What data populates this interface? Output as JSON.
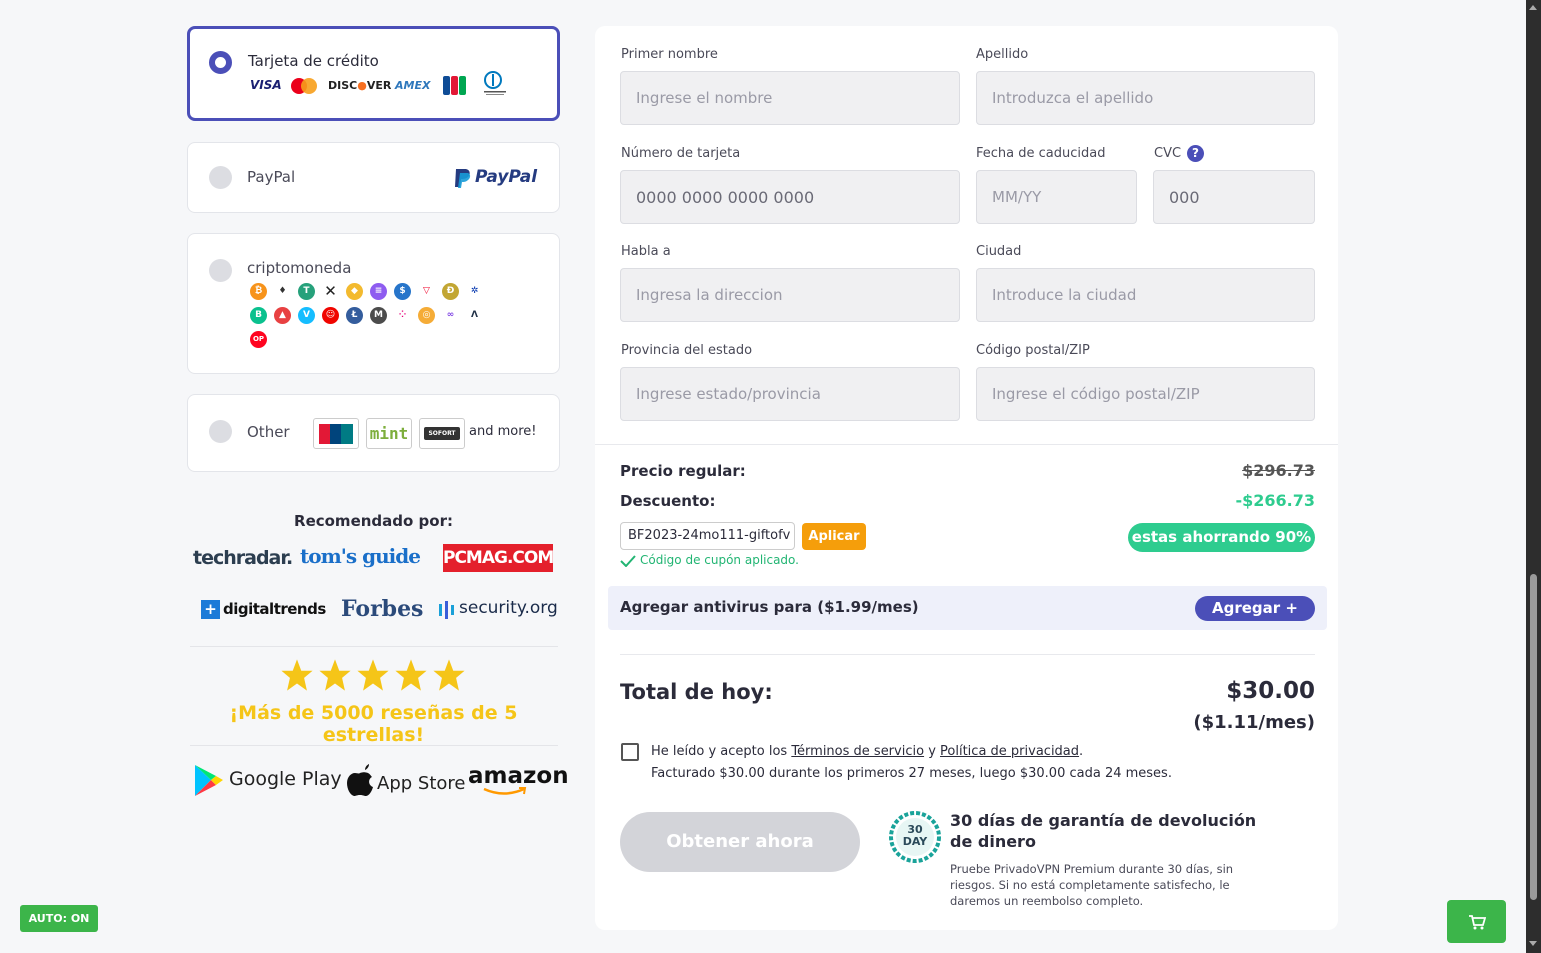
{
  "payment_methods": {
    "credit_card": {
      "title": "Tarjeta de crédito",
      "brands": [
        "VISA",
        "DISCOVER",
        "AMEX",
        "JCB",
        "Diners Club"
      ]
    },
    "paypal": {
      "title": "PayPal",
      "logo_text": "PayPal"
    },
    "crypto": {
      "title": "criptomoneda"
    },
    "other": {
      "title": "Other",
      "mint": "mint",
      "sofort": "SOFORT",
      "more": "and more!"
    }
  },
  "recommended": {
    "title": "Recomendado por:",
    "press": [
      "techradar.",
      "tom's guide",
      "PCMAG.COM",
      "digitaltrends",
      "Forbes",
      "security.org"
    ]
  },
  "reviews": "¡Más de 5000 reseñas de 5 estrellas!",
  "stores": {
    "google": "Google Play",
    "apple": "App Store",
    "amazon": "amazon"
  },
  "form": {
    "first_name": {
      "label": "Primer nombre",
      "placeholder": "Ingrese el nombre"
    },
    "last_name": {
      "label": "Apellido",
      "placeholder": "Introduzca el apellido"
    },
    "card_number": {
      "label": "Número de tarjeta",
      "placeholder": "0000 0000 0000 0000"
    },
    "expiry": {
      "label": "Fecha de caducidad",
      "placeholder": "MM/YY"
    },
    "cvc": {
      "label": "CVC",
      "placeholder": "000"
    },
    "address": {
      "label": "Habla a",
      "placeholder": "Ingresa la direccion"
    },
    "city": {
      "label": "Ciudad",
      "placeholder": "Introduce la ciudad"
    },
    "state": {
      "label": "Provincia del estado",
      "placeholder": "Ingrese estado/provincia"
    },
    "zip": {
      "label": "Código postal/ZIP",
      "placeholder": "Ingrese el código postal/ZIP"
    }
  },
  "summary": {
    "regular_label": "Precio regular:",
    "regular_value": "$296.73",
    "discount_label": "Descuento:",
    "discount_value": "-$266.73",
    "coupon_code": "BF2023-24mo111-giftofv",
    "apply_label": "Aplicar",
    "coupon_applied": "Código de cupón aplicado.",
    "savings": "estas ahorrando 90%",
    "antivirus_label": "Agregar antivirus para ($1.99/mes)",
    "antivirus_button": "Agregar +",
    "total_label": "Total de hoy:",
    "total_value": "$30.00",
    "total_monthly": "($1.11/mes)"
  },
  "terms": {
    "prefix": "He leído y acepto los ",
    "tos": "Términos de servicio",
    "and": " y ",
    "privacy": "Política de privacidad",
    "suffix": ".",
    "billing": "Facturado $30.00 durante los primeros 27 meses, luego $30.00 cada 24 meses."
  },
  "cta": "Obtener ahora",
  "guarantee": {
    "badge_top": "30",
    "badge_bottom": "DAY",
    "title": "30 días de garantía de devolución de dinero",
    "text": "Pruebe PrivadoVPN Premium durante 30 días, sin riesgos. Si no está completamente satisfecho, le daremos un reembolso completo."
  },
  "auto_badge": "AUTO: ON",
  "colors": {
    "accent": "#4b4fb8",
    "success": "#2ecc8f",
    "warning": "#f59e0b",
    "star": "#f5c518",
    "green": "#3cb54a"
  }
}
